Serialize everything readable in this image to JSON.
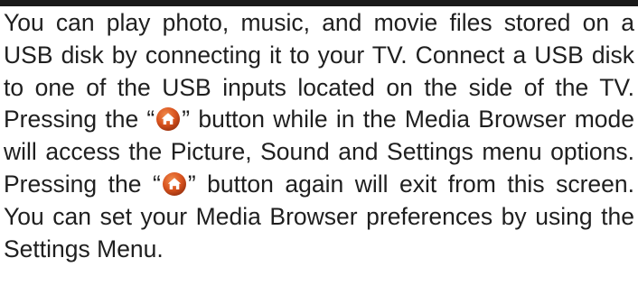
{
  "paragraph": {
    "part1": "You can play photo, music, and movie files stored on a USB disk by connecting it to your TV. Connect a USB disk to one of the USB inputs located on the side of the TV. Pressing the “",
    "part2": "” button while in the Media Browser mode will access the Picture, Sound and Settings menu options. Pressing the “",
    "part3": "” button again will exit from this screen. You can set your Media Browser preferences by using the Settings Menu."
  },
  "icons": {
    "home_button": "home-icon"
  },
  "colors": {
    "rule": "#1a1a1a",
    "text": "#1f1f1f",
    "home_button_fill": "#d9531e",
    "home_button_glyph": "#ffffff"
  }
}
